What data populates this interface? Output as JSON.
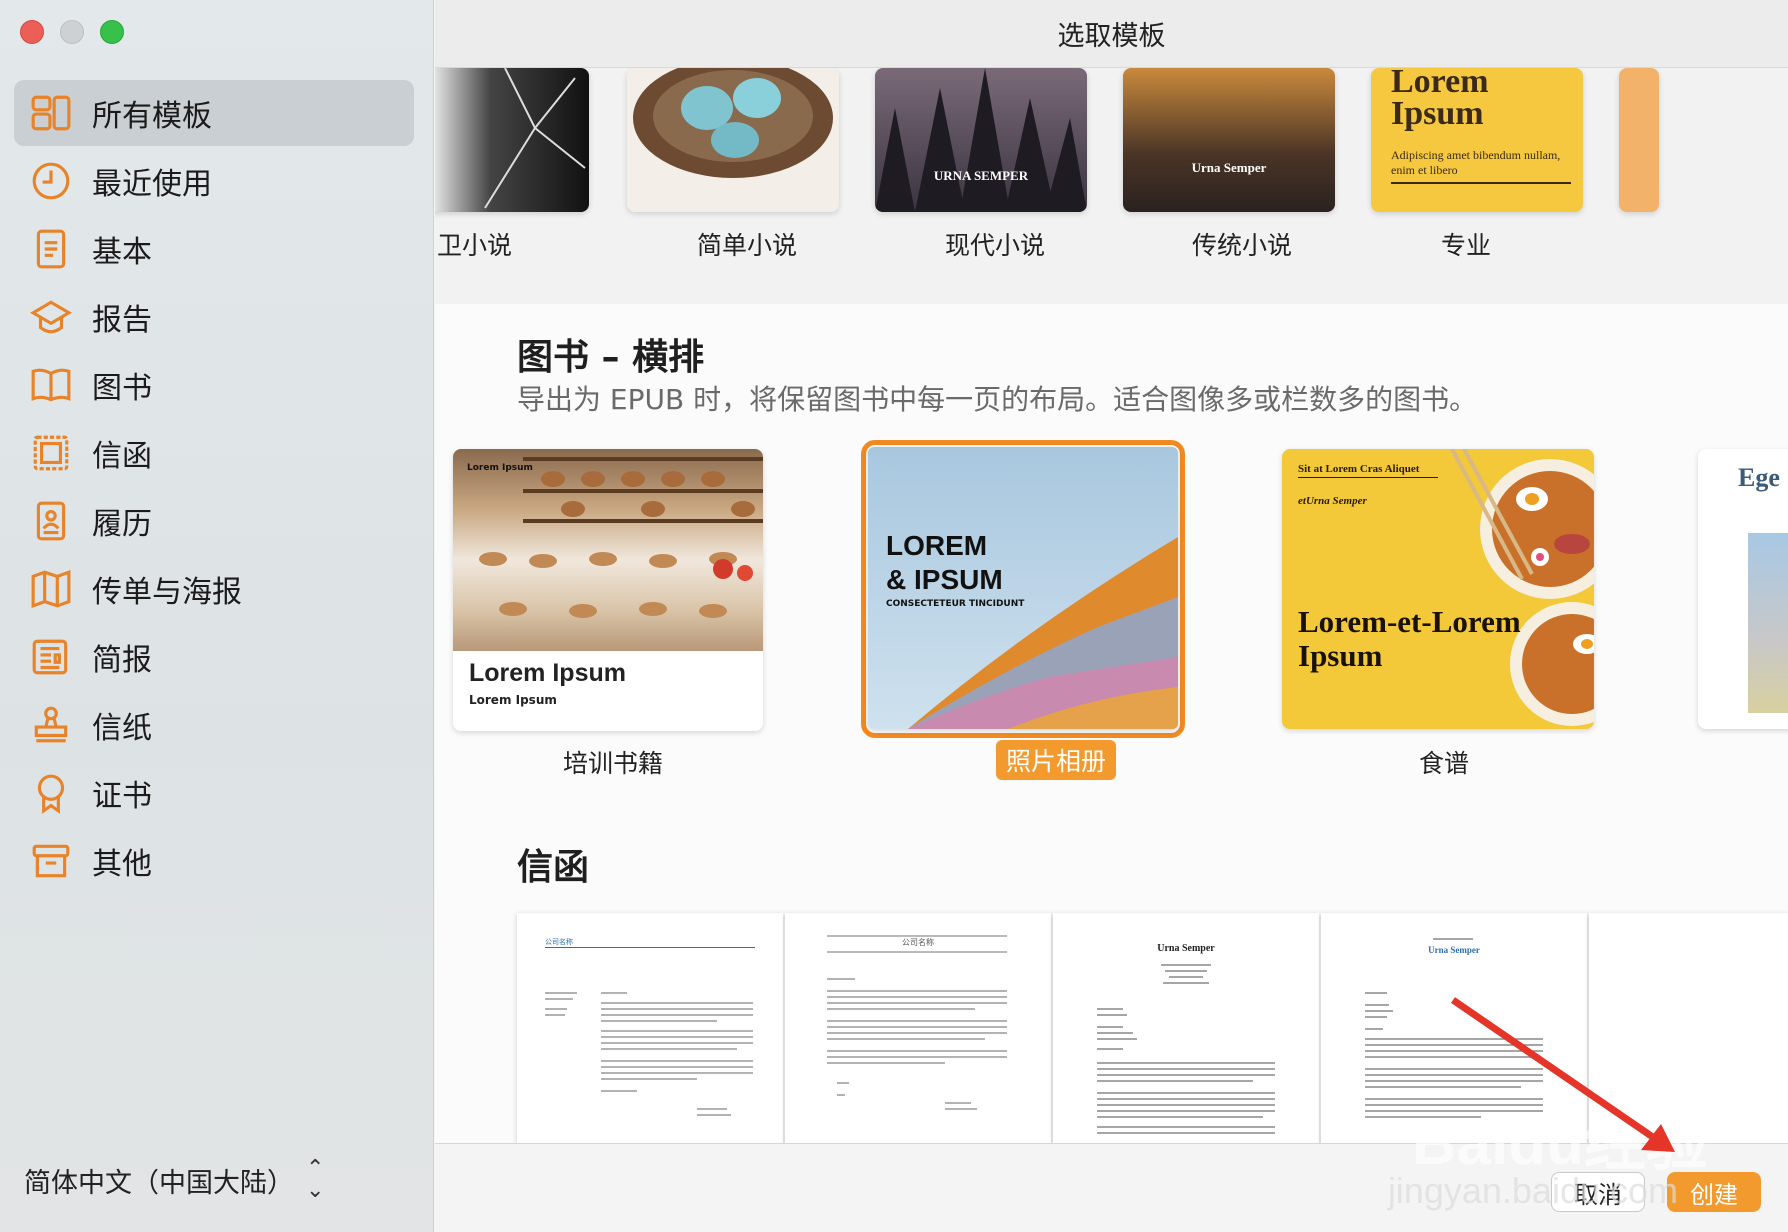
{
  "window": {
    "title": "选取模板"
  },
  "sidebar": {
    "items": [
      {
        "label": "所有模板",
        "icon": "grid-icon",
        "active": true
      },
      {
        "label": "最近使用",
        "icon": "clock-icon"
      },
      {
        "label": "基本",
        "icon": "document-icon"
      },
      {
        "label": "报告",
        "icon": "graduation-cap-icon"
      },
      {
        "label": "图书",
        "icon": "book-icon"
      },
      {
        "label": "信函",
        "icon": "stamp-frame-icon"
      },
      {
        "label": "履历",
        "icon": "resume-icon"
      },
      {
        "label": "传单与海报",
        "icon": "map-icon"
      },
      {
        "label": "简报",
        "icon": "newspaper-icon"
      },
      {
        "label": "信纸",
        "icon": "stamp-icon"
      },
      {
        "label": "证书",
        "icon": "ribbon-icon"
      },
      {
        "label": "其他",
        "icon": "archive-box-icon"
      }
    ],
    "language": "简体中文（中国大陆）"
  },
  "top_row": {
    "templates": [
      {
        "label": "卫小说"
      },
      {
        "label": "简单小说"
      },
      {
        "label": "现代小说",
        "cover_text": "URNA SEMPER"
      },
      {
        "label": "传统小说",
        "cover_text": "Urna Semper"
      },
      {
        "label": "专业",
        "cover_title": "Lorem Ipsum",
        "cover_sub": "Adipiscing amet bibendum nullam, enim et libero"
      }
    ]
  },
  "books_landscape": {
    "title": "图书 – 横排",
    "description": "导出为 EPUB 时，将保留图书中每一页的布局。适合图像多或栏数多的图书。",
    "templates": [
      {
        "label": "培训书籍",
        "cover_small": "Lorem Ipsum",
        "cover_title": "Lorem Ipsum",
        "cover_sub": "Lorem Ipsum"
      },
      {
        "label": "照片相册",
        "cover_title_1": "LOREM",
        "cover_title_2": "& IPSUM",
        "cover_sub": "CONSECTETEUR TINCIDUNT",
        "selected": true
      },
      {
        "label": "食谱",
        "cover_top": "Sit at Lorem Cras Aliquet",
        "cover_author": "etUrna Semper",
        "cover_title_1": "Lorem-et-Lorem",
        "cover_title_2": "Ipsum"
      },
      {
        "label": "",
        "cover_text": "Ege"
      }
    ]
  },
  "letters": {
    "title": "信函",
    "templates": [
      {
        "header": "公司名称"
      },
      {
        "header": "公司名称"
      },
      {
        "header": "Urna Semper"
      },
      {
        "header": "Urna Semper"
      }
    ]
  },
  "footer": {
    "cancel": "取消",
    "create": "创建"
  },
  "watermark": {
    "text": "Baidu经验",
    "sub": "jingyan.baidu.com"
  },
  "colors": {
    "accent": "#f39a2f",
    "icon": "#e8832a"
  }
}
